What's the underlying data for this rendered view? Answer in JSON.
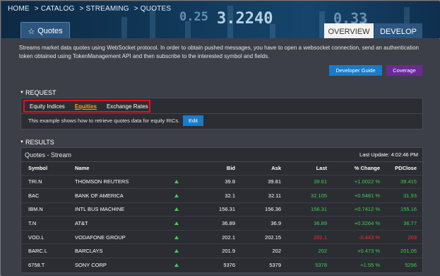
{
  "breadcrumb": [
    "HOME",
    "> CATALOG",
    "> STREAMING",
    "> QUOTES"
  ],
  "banner_numbers": [
    "0.25",
    "3.2240",
    "0.33"
  ],
  "header": {
    "title_tab": "Quotes",
    "tabs": [
      {
        "label": "OVERVIEW",
        "active": true
      },
      {
        "label": "DEVELOP",
        "active": false
      }
    ]
  },
  "description": "Streams market data quotes using WebSocket protocol. In order to obtain pushed messages, you have to open a websocket connection, send an authentication token obtained using TokenManagement API and then subscribe to the interested symbol and fields.",
  "buttons": {
    "developer_guide": "Developer Guide",
    "coverage": "Coverage"
  },
  "request": {
    "heading": "REQUEST",
    "tabs": [
      {
        "label": "Equity Indices",
        "active": false
      },
      {
        "label": "Equities",
        "active": true
      },
      {
        "label": "Exchange Rates",
        "active": false
      }
    ],
    "note": "This example shows how to retrieve quotes data for equity RICs.",
    "edit_label": "Edit"
  },
  "results": {
    "heading": "RESULTS",
    "title": "Quotes - Stream",
    "last_update": "Last Update: 4:02:46 PM",
    "columns": [
      "Symbol",
      "Name",
      "",
      "Bid",
      "Ask",
      "Last",
      "% Change",
      "PDClose"
    ],
    "rows": [
      {
        "symbol": "TRI.N",
        "name": "THOMSON REUTERS",
        "bid": "39.8",
        "ask": "39.81",
        "last": "39.61",
        "change": "+1.0022 %",
        "pdclose": "39.415",
        "dir": "green"
      },
      {
        "symbol": "BAC",
        "name": "BANK OF AMERICA",
        "bid": "32.1",
        "ask": "32.11",
        "last": "32.105",
        "change": "+0.5481 %",
        "pdclose": "31.93",
        "dir": "green"
      },
      {
        "symbol": "IBM.N",
        "name": "INTL BUS MACHINE",
        "bid": "156.31",
        "ask": "156.36",
        "last": "156.31",
        "change": "+0.7412 %",
        "pdclose": "155.16",
        "dir": "green"
      },
      {
        "symbol": "T.N",
        "name": "AT&T",
        "bid": "36.89",
        "ask": "36.9",
        "last": "36.89",
        "change": "+0.3264 %",
        "pdclose": "36.77",
        "dir": "green"
      },
      {
        "symbol": "VOD.L",
        "name": "VODAFONE GROUP",
        "bid": "202.1",
        "ask": "202.15",
        "last": "202.1",
        "change": "-0.443 %",
        "pdclose": "203",
        "dir": "red"
      },
      {
        "symbol": "BARC.L",
        "name": "BARCLAYS",
        "bid": "201.9",
        "ask": "202",
        "last": "202",
        "change": "+0.473 %",
        "pdclose": "201.05",
        "dir": "green"
      },
      {
        "symbol": "6758.T",
        "name": "SONY CORP",
        "bid": "5376",
        "ask": "5379",
        "last": "5378",
        "change": "+1.55 %",
        "pdclose": "5296",
        "dir": "green"
      }
    ]
  },
  "colors": {
    "background": "#3c3f47",
    "panel": "#2b2d33",
    "accent_blue": "#1a7bc7",
    "coverage_purple": "#6a2a94",
    "active_tab_orange": "#f5a21b",
    "highlight_red_border": "#e0121a",
    "positive_green": "#3ed04a",
    "negative_red": "#ff2a2a"
  }
}
